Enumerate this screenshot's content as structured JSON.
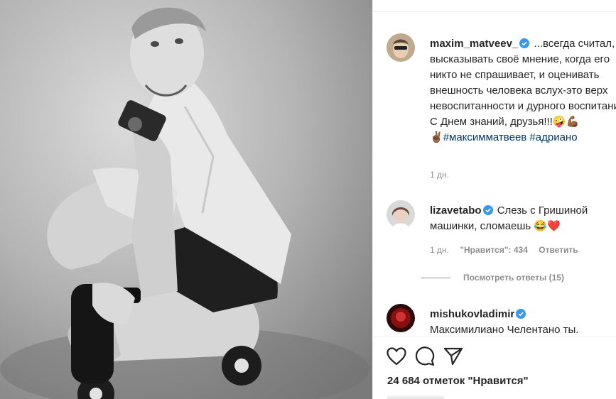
{
  "post": {
    "author": "maxim_matveev_",
    "caption": "...всегда считал, что высказывать своё мнение, когда его никто не спрашивает, и оценивать внешность человека вслух-это верх невоспитанности и дурного воспитания... С Днем знаний, друзья!!!",
    "caption_emoji": "🤪💪🏾",
    "hashtag_prefix": "✌🏾",
    "hashtags": "#максимматвеев #адриано",
    "time": "1 дн."
  },
  "comments": [
    {
      "user": "lizavetabo",
      "text": "Слезь с Гришиной машинки, сломаешь",
      "emoji": "😂❤️",
      "time": "1 дн.",
      "likes": "\"Нравится\": 434",
      "reply": "Ответить",
      "view_replies": "Посмотреть ответы (15)"
    },
    {
      "user": "mishukovladimir",
      "text": "Максимилиано Челентано ты."
    }
  ],
  "actions": {
    "like_icon": "heart-icon",
    "comment_icon": "comment-icon",
    "share_icon": "paper-plane-icon"
  },
  "likes_text": "24 684 отметок \"Нравится\"",
  "colors": {
    "verified": "#3897f0",
    "hashtag": "#00376b",
    "muted": "#8e8e8e"
  }
}
